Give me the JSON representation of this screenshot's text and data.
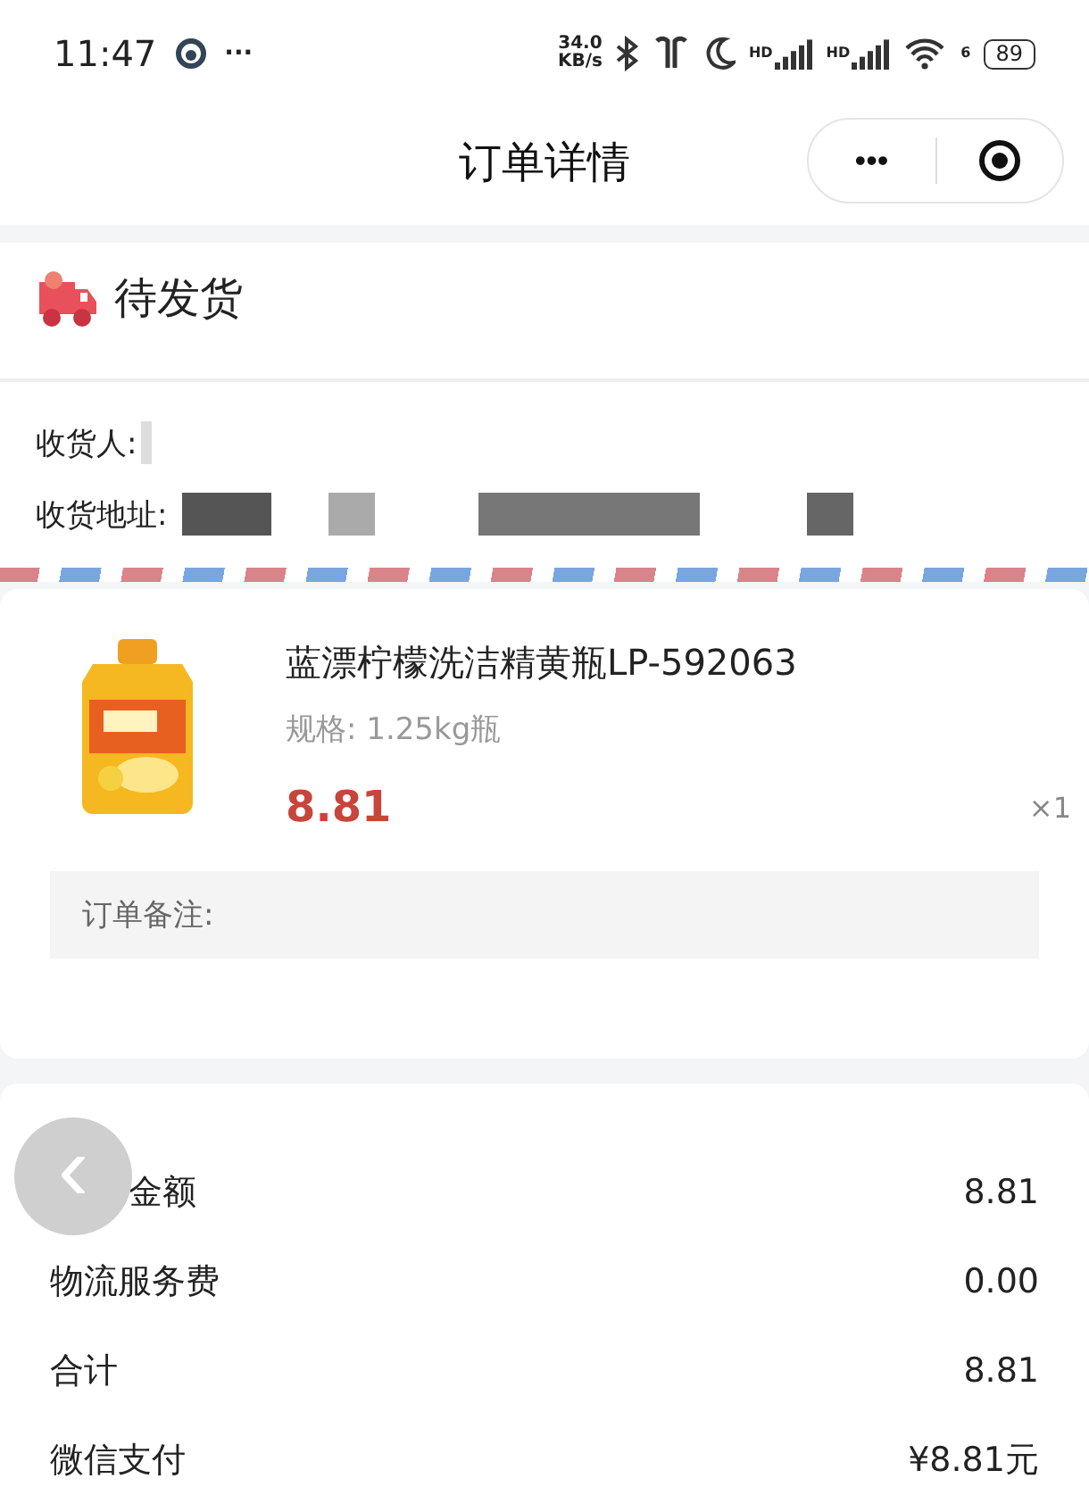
{
  "status_bar": {
    "time": "11:47",
    "more": "···",
    "speed_value": "34.0",
    "speed_unit": "KB/s",
    "sim_labels": [
      "HD",
      "HD"
    ],
    "wifi_label": "6",
    "battery": "89"
  },
  "nav": {
    "title": "订单详情",
    "more": "•••"
  },
  "order_status": {
    "label": "待发货"
  },
  "address": {
    "receiver_label": "收货人:",
    "address_label": "收货地址:"
  },
  "product": {
    "name": "蓝漂柠檬洗洁精黄瓶LP-592063",
    "spec": "规格:  1.25kg瓶",
    "price": "8.81",
    "quantity": "×1",
    "note_label": "订单备注:"
  },
  "summary": [
    {
      "label": "金额",
      "value": "8.81"
    },
    {
      "label": "物流服务费",
      "value": "0.00"
    },
    {
      "label": "合计",
      "value": "8.81"
    },
    {
      "label": "微信支付",
      "value": "¥8.81元"
    }
  ],
  "back_button": {
    "glyph": "‹"
  }
}
